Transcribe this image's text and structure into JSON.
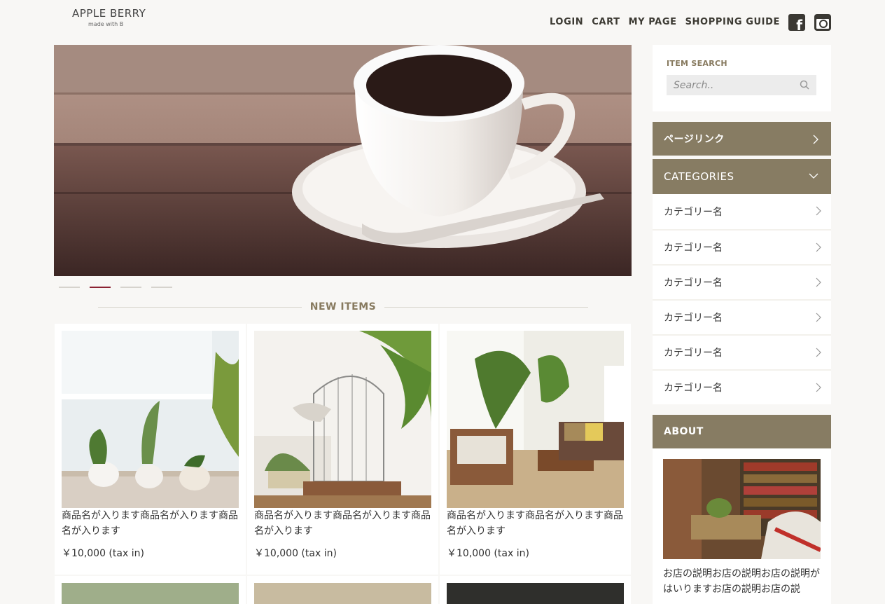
{
  "header": {
    "logo_title": "APPLE BERRY",
    "logo_sub": "made with B",
    "nav": [
      "LOGIN",
      "CART",
      "MY PAGE",
      "SHOPPING GUIDE"
    ]
  },
  "slider": {
    "slide_count": 4,
    "active_index": 1
  },
  "new_items": {
    "title": "NEW ITEMS",
    "items": [
      {
        "name": "商品名が入ります商品名が入ります商品名が入ります",
        "price": "￥10,000 (tax in)"
      },
      {
        "name": "商品名が入ります商品名が入ります商品名が入ります",
        "price": "￥10,000 (tax in)"
      },
      {
        "name": "商品名が入ります商品名が入ります商品名が入ります",
        "price": "￥10,000 (tax in)"
      }
    ]
  },
  "sidebar": {
    "search_label": "ITEM SEARCH",
    "search_placeholder": "Search..",
    "page_link": "ページリンク",
    "categories_title": "CATEGORIES",
    "categories": [
      "カテゴリー名",
      "カテゴリー名",
      "カテゴリー名",
      "カテゴリー名",
      "カテゴリー名",
      "カテゴリー名"
    ],
    "about_title": "ABOUT",
    "about_text": "お店の説明お店の説明お店の説明がはいりますお店の説明お店の説"
  },
  "colors": {
    "accent": "#877c63",
    "active_dot": "#8b2232",
    "background": "#f8f7f5"
  }
}
